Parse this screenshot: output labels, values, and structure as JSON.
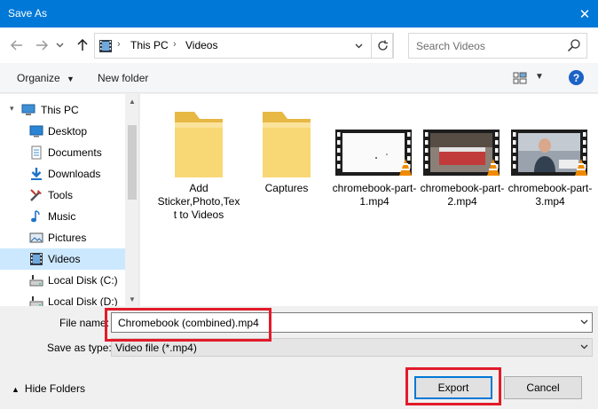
{
  "window": {
    "title": "Save As",
    "close_glyph": "✕"
  },
  "nav": {
    "back_icon": "arrow-left-icon",
    "forward_icon": "arrow-right-icon",
    "history_icon": "chevron-down-icon",
    "up_icon": "arrow-up-icon",
    "breadcrumbs": [
      "This PC",
      "Videos"
    ],
    "refresh_icon": "refresh-icon",
    "search_placeholder": "Search Videos"
  },
  "toolbar": {
    "organize_label": "Organize",
    "new_folder_label": "New folder",
    "help_label": "?"
  },
  "sidebar": {
    "items": [
      {
        "label": "This PC",
        "icon": "pc-icon"
      },
      {
        "label": "Desktop",
        "icon": "desktop-icon"
      },
      {
        "label": "Documents",
        "icon": "documents-icon"
      },
      {
        "label": "Downloads",
        "icon": "download-icon"
      },
      {
        "label": "Tools",
        "icon": "tools-icon"
      },
      {
        "label": "Music",
        "icon": "music-icon"
      },
      {
        "label": "Pictures",
        "icon": "pictures-icon"
      },
      {
        "label": "Videos",
        "icon": "videos-icon",
        "selected": true
      },
      {
        "label": "Local Disk (C:)",
        "icon": "drive-icon"
      },
      {
        "label": "Local Disk (D:)",
        "icon": "drive-icon"
      }
    ]
  },
  "files": [
    {
      "name": "Add Sticker,Photo,Text to Videos",
      "type": "folder"
    },
    {
      "name": "Captures",
      "type": "folder"
    },
    {
      "name": "chromebook-part-1.mp4",
      "type": "video"
    },
    {
      "name": "chromebook-part-2.mp4",
      "type": "video"
    },
    {
      "name": "chromebook-part-3.mp4",
      "type": "video"
    }
  ],
  "form": {
    "file_name_label": "File name:",
    "file_name_value": "Chromebook (combined).mp4",
    "save_type_label": "Save as type:",
    "save_type_value": "Video file (*.mp4)"
  },
  "footer": {
    "hide_folders_label": "Hide Folders",
    "export_label": "Export",
    "cancel_label": "Cancel"
  },
  "colors": {
    "titlebar": "#0078d7",
    "selection": "#cce8ff",
    "highlight": "#e21b2a",
    "folder": "#f8d775"
  }
}
